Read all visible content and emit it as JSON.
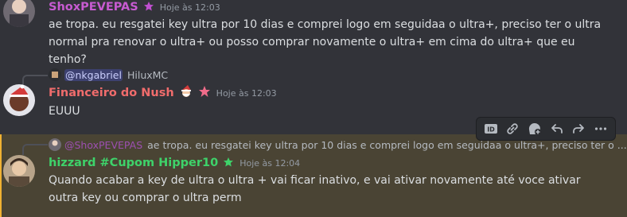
{
  "messages": [
    {
      "author": "ShoxPEVEPAS",
      "author_color": "#c75bd1",
      "timestamp": "Hoje às 12:03",
      "body": "ae tropa. eu resgatei key ultra por 10 dias e comprei logo em seguidaa o ultra+, preciso ter o ultra normal pra renovar o ultra+ ou posso comprar novamente o ultra+ em cima do ultra+ que eu tenho?"
    },
    {
      "reply": {
        "mention": "@nkgabriel",
        "text": "HiluxMC"
      },
      "author": "Financeiro do Nush",
      "author_color": "#f06c6c",
      "timestamp": "Hoje às 12:03",
      "body": "EUUU"
    },
    {
      "reply": {
        "mention": "@ShoxPEVEPAS",
        "text": "ae tropa. eu resgatei key ultra por 10 dias e comprei logo em seguidaa o ultra+, preciso ter o ..."
      },
      "author": "hizzard #Cupom Hipper10",
      "author_color": "#3ed36a",
      "timestamp": "Hoje às 12:04",
      "body": "Quando acabar a key de ultra o ultra + vai ficar inativo, e vai ativar novamente até voce ativar outra key ou comprar o ultra perm"
    }
  ],
  "toolbar": {
    "icons": [
      "id-icon",
      "link-icon",
      "add-reaction-icon",
      "reply-icon",
      "forward-icon",
      "more-icon"
    ]
  }
}
